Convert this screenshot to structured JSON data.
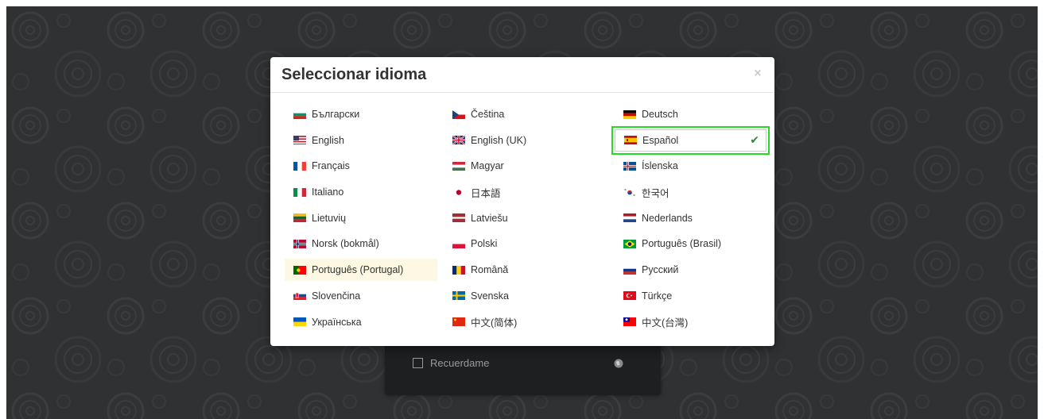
{
  "modal": {
    "title": "Seleccionar idioma",
    "close_glyph": "×"
  },
  "languages": [
    {
      "label": "Български",
      "flag": "bg"
    },
    {
      "label": "Čeština",
      "flag": "cz"
    },
    {
      "label": "Deutsch",
      "flag": "de"
    },
    {
      "label": "English",
      "flag": "us"
    },
    {
      "label": "English (UK)",
      "flag": "gb"
    },
    {
      "label": "Español",
      "flag": "es",
      "selected": true
    },
    {
      "label": "Français",
      "flag": "fr"
    },
    {
      "label": "Magyar",
      "flag": "hu"
    },
    {
      "label": "Íslenska",
      "flag": "is"
    },
    {
      "label": "Italiano",
      "flag": "it"
    },
    {
      "label": "日本語",
      "flag": "jp"
    },
    {
      "label": "한국어",
      "flag": "kr"
    },
    {
      "label": "Lietuvių",
      "flag": "lt"
    },
    {
      "label": "Latviešu",
      "flag": "lv"
    },
    {
      "label": "Nederlands",
      "flag": "nl"
    },
    {
      "label": "Norsk (bokmål)",
      "flag": "no"
    },
    {
      "label": "Polski",
      "flag": "pl"
    },
    {
      "label": "Português (Brasil)",
      "flag": "br"
    },
    {
      "label": "Português (Portugal)",
      "flag": "pt",
      "hover": true
    },
    {
      "label": "Română",
      "flag": "ro"
    },
    {
      "label": "Русский",
      "flag": "ru"
    },
    {
      "label": "Slovenčina",
      "flag": "sk"
    },
    {
      "label": "Svenska",
      "flag": "se"
    },
    {
      "label": "Türkçe",
      "flag": "tr"
    },
    {
      "label": "Українська",
      "flag": "ua"
    },
    {
      "label": "中文(简体)",
      "flag": "cn"
    },
    {
      "label": "中文(台灣)",
      "flag": "tw"
    }
  ],
  "login": {
    "remember_label": "Recuerdame"
  },
  "icons": {
    "check": "check-icon",
    "globe": "globe-icon",
    "close": "close-icon"
  },
  "colors": {
    "selected_outline": "#22dd22",
    "check": "#2e8b2e",
    "hover_bg": "#fcf8e3"
  }
}
